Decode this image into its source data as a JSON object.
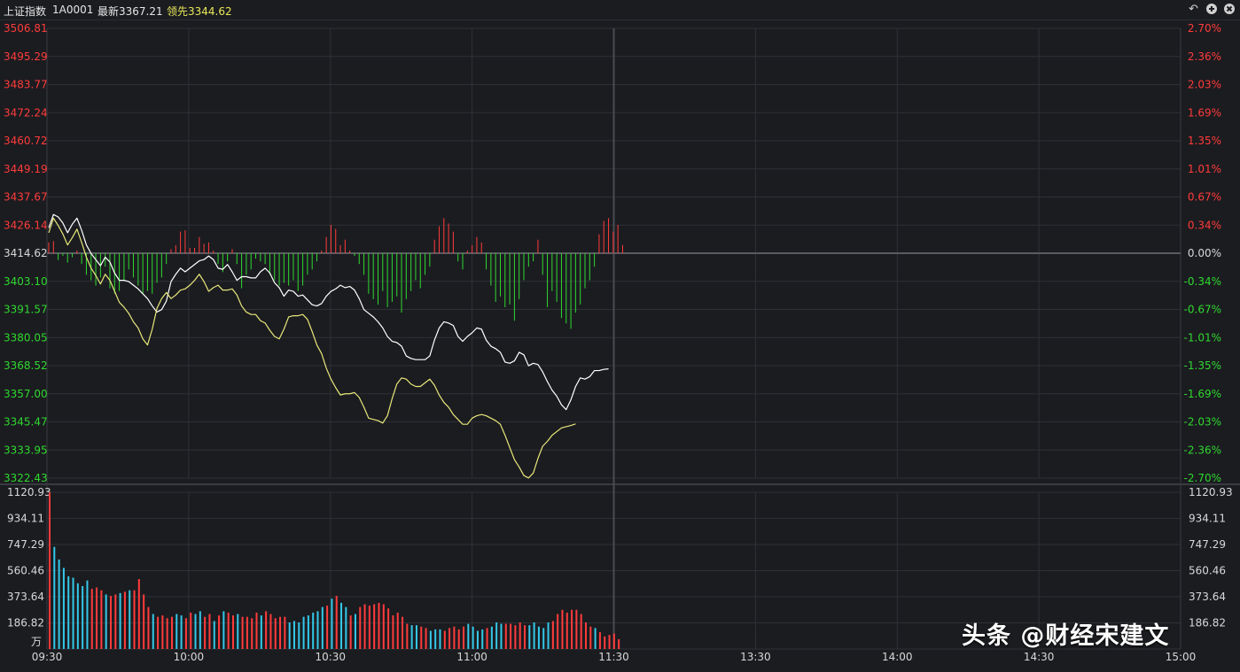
{
  "header": {
    "title": "上证指数",
    "code": "1A0001",
    "latest": "最新3367.21",
    "lead": "领先3344.62",
    "icons": [
      "undo-icon",
      "zoom-in-icon",
      "close-icon"
    ]
  },
  "watermark": "头条 @财经宋建文",
  "colors": {
    "bg": "#1b1c20",
    "grid": "#2f3036",
    "up": "#ff3b3b",
    "down": "#2fd82f",
    "price": "#ffffff",
    "lead": "#e8e87a",
    "vol_up": "#ff3b3b",
    "vol_down": "#34c8e8"
  },
  "chart_data": {
    "type": "line",
    "title": "上证指数",
    "prev_close": 3414.62,
    "price_axis": {
      "ylim": [
        3322.43,
        3506.81
      ],
      "left_ticks": [
        "3506.81",
        "3495.29",
        "3483.77",
        "3472.24",
        "3460.72",
        "3449.19",
        "3437.67",
        "3426.14",
        "3414.62",
        "3403.10",
        "3391.57",
        "3380.05",
        "3368.52",
        "3357.00",
        "3345.47",
        "3333.95",
        "3322.43"
      ],
      "right_ticks": [
        "2.70%",
        "2.36%",
        "2.03%",
        "1.69%",
        "1.35%",
        "1.01%",
        "0.67%",
        "0.34%",
        "0.00%",
        "-0.34%",
        "-0.67%",
        "-1.01%",
        "-1.35%",
        "-1.69%",
        "-2.03%",
        "-2.36%",
        "-2.70%"
      ]
    },
    "volume_axis": {
      "ylim": [
        0,
        1120.93
      ],
      "ticks": [
        "1120.93",
        "934.11",
        "747.29",
        "560.46",
        "373.64",
        "186.82"
      ],
      "unit": "万"
    },
    "x_ticks": [
      "09:30",
      "10:00",
      "10:30",
      "11:00",
      "11:30",
      "13:30",
      "14:00",
      "14:30",
      "15:00"
    ],
    "minutes_shown": 121,
    "total_minutes": 241,
    "series": [
      {
        "name": "最新",
        "values": [
          3425.0,
          3430.5,
          3429.5,
          3427.0,
          3423.0,
          3426.5,
          3429.0,
          3424.0,
          3418.0,
          3414.5,
          3412.0,
          3409.5,
          3413.0,
          3411.0,
          3406.5,
          3403.5,
          3403.5,
          3403.0,
          3401.5,
          3400.0,
          3398.0,
          3396.0,
          3393.0,
          3390.5,
          3391.5,
          3395.0,
          3403.0,
          3406.0,
          3408.5,
          3407.0,
          3408.5,
          3410.0,
          3411.5,
          3412.0,
          3413.5,
          3412.0,
          3408.5,
          3408.0,
          3410.0,
          3407.0,
          3403.5,
          3405.0,
          3405.0,
          3404.5,
          3404.5,
          3407.0,
          3408.5,
          3406.5,
          3402.5,
          3400.5,
          3397.0,
          3399.5,
          3399.0,
          3397.0,
          3397.5,
          3395.5,
          3393.5,
          3393.0,
          3394.0,
          3397.0,
          3399.0,
          3400.0,
          3401.5,
          3400.5,
          3401.0,
          3399.5,
          3396.0,
          3391.5,
          3390.0,
          3388.5,
          3386.5,
          3384.0,
          3380.5,
          3378.5,
          3378.0,
          3376.5,
          3372.5,
          3371.5,
          3371.0,
          3371.0,
          3371.0,
          3372.5,
          3379.0,
          3384.0,
          3386.5,
          3386.0,
          3385.0,
          3380.5,
          3378.5,
          3380.5,
          3382.0,
          3384.0,
          3383.5,
          3379.0,
          3376.5,
          3375.5,
          3374.0,
          3370.0,
          3369.5,
          3370.5,
          3374.0,
          3373.0,
          3368.5,
          3369.5,
          3369.0,
          3366.0,
          3362.0,
          3358.5,
          3356.0,
          3352.5,
          3350.5,
          3354.5,
          3360.0,
          3363.5,
          3363.0,
          3364.0,
          3366.5,
          3366.5,
          3367.0,
          3367.21
        ],
        "color": "#ffffff"
      },
      {
        "name": "领先",
        "values": [
          3423.0,
          3429.0,
          3426.0,
          3422.5,
          3418.0,
          3421.0,
          3424.5,
          3419.0,
          3413.0,
          3408.5,
          3405.5,
          3402.0,
          3406.0,
          3403.5,
          3399.0,
          3394.5,
          3392.5,
          3390.0,
          3386.5,
          3384.0,
          3379.5,
          3377.0,
          3383.5,
          3392.0,
          3396.0,
          3398.5,
          3396.0,
          3397.5,
          3399.5,
          3400.0,
          3401.5,
          3403.5,
          3406.0,
          3403.0,
          3399.0,
          3400.5,
          3401.5,
          3399.5,
          3399.5,
          3400.0,
          3397.5,
          3393.0,
          3390.5,
          3389.5,
          3389.5,
          3387.0,
          3386.0,
          3383.0,
          3380.5,
          3379.5,
          3383.5,
          3388.5,
          3389.0,
          3389.0,
          3389.5,
          3387.5,
          3382.5,
          3377.0,
          3373.5,
          3367.5,
          3363.0,
          3359.5,
          3356.5,
          3357.0,
          3357.0,
          3357.5,
          3355.5,
          3351.5,
          3347.0,
          3346.5,
          3346.0,
          3345.0,
          3348.0,
          3355.0,
          3361.0,
          3363.5,
          3363.0,
          3361.0,
          3360.0,
          3360.0,
          3361.5,
          3363.0,
          3360.5,
          3356.5,
          3353.5,
          3351.5,
          3348.5,
          3346.5,
          3344.5,
          3344.5,
          3347.0,
          3348.0,
          3348.5,
          3348.0,
          3347.0,
          3346.0,
          3344.5,
          3340.0,
          3335.0,
          3330.0,
          3327.0,
          3323.5,
          3322.5,
          3324.5,
          3330.5,
          3335.5,
          3337.5,
          3340.0,
          3341.5,
          3343.0,
          3343.5,
          3344.0,
          3344.62
        ],
        "color": "#e8e87a"
      }
    ],
    "lead_bars": [
      4,
      4.5,
      -2.5,
      -1,
      -3.5,
      -1.5,
      1,
      -4,
      -8,
      -10,
      -12,
      -9,
      -5,
      -13,
      -15,
      -14,
      -10,
      -6,
      -9,
      -12,
      -15,
      -14,
      -15,
      -11,
      -9,
      -4,
      1.5,
      3,
      8,
      8.5,
      2,
      2,
      6,
      3.5,
      4,
      1,
      -4,
      -7,
      -3,
      1.5,
      -4,
      -13,
      -8,
      -6,
      -2,
      -3,
      -4,
      -8,
      -10,
      -12,
      -11,
      -12,
      -10,
      -14,
      -12,
      -8,
      -6,
      -3,
      1,
      6,
      10.5,
      9,
      3,
      5,
      1,
      -1,
      -4,
      -8,
      -15,
      -17,
      -19,
      -14,
      -20,
      -18,
      -16,
      -22,
      -17,
      -14,
      -10,
      -13,
      -8,
      -5,
      5,
      10,
      13,
      11,
      8,
      -3,
      -6,
      1,
      3,
      6,
      4,
      -6,
      -12,
      -18,
      -16,
      -20,
      -19,
      -25,
      -17,
      -10,
      -5,
      -3,
      5,
      -8,
      -20,
      -14,
      -18,
      -24,
      -26,
      -28,
      -22,
      -19,
      -13,
      -10,
      -5,
      7,
      12,
      13,
      8,
      10.5,
      3
    ],
    "volume": [
      1120,
      730,
      640,
      580,
      520,
      510,
      470,
      450,
      490,
      430,
      440,
      420,
      390,
      380,
      390,
      400,
      410,
      420,
      420,
      500,
      390,
      300,
      250,
      230,
      240,
      220,
      230,
      250,
      240,
      220,
      260,
      250,
      270,
      230,
      250,
      200,
      240,
      270,
      260,
      240,
      250,
      230,
      230,
      220,
      260,
      240,
      270,
      250,
      220,
      230,
      230,
      190,
      200,
      190,
      230,
      240,
      260,
      270,
      300,
      310,
      360,
      380,
      330,
      300,
      240,
      250,
      300,
      320,
      310,
      320,
      330,
      320,
      290,
      240,
      260,
      230,
      180,
      170,
      170,
      160,
      150,
      130,
      140,
      140,
      130,
      150,
      160,
      140,
      160,
      180,
      160,
      130,
      140,
      150,
      160,
      190,
      180,
      180,
      180,
      170,
      190,
      170,
      170,
      190,
      160,
      150,
      190,
      200,
      250,
      280,
      260,
      280,
      280,
      250,
      190,
      160,
      150,
      120,
      90,
      100,
      110,
      70
    ],
    "volume_up": [
      1,
      0,
      0,
      0,
      0,
      0,
      0,
      0,
      0,
      1,
      1,
      1,
      0,
      1,
      1,
      0,
      1,
      0,
      1,
      1,
      1,
      1,
      0,
      1,
      1,
      1,
      1,
      0,
      0,
      1,
      1,
      0,
      0,
      1,
      1,
      0,
      1,
      0,
      1,
      1,
      0,
      1,
      1,
      1,
      1,
      0,
      1,
      1,
      1,
      1,
      1,
      0,
      0,
      0,
      0,
      0,
      0,
      0,
      0,
      1,
      0,
      1,
      0,
      0,
      1,
      0,
      1,
      1,
      1,
      1,
      1,
      1,
      1,
      1,
      1,
      1,
      1,
      0,
      0,
      1,
      1,
      0,
      0,
      0,
      1,
      1,
      1,
      1,
      1,
      0,
      0,
      0,
      0,
      1,
      0,
      0,
      0,
      1,
      1,
      1,
      1,
      1,
      0,
      0,
      0,
      0,
      0,
      1,
      1,
      1,
      1,
      1,
      1,
      1,
      1,
      1,
      0,
      1,
      1,
      1,
      1,
      1
    ]
  }
}
